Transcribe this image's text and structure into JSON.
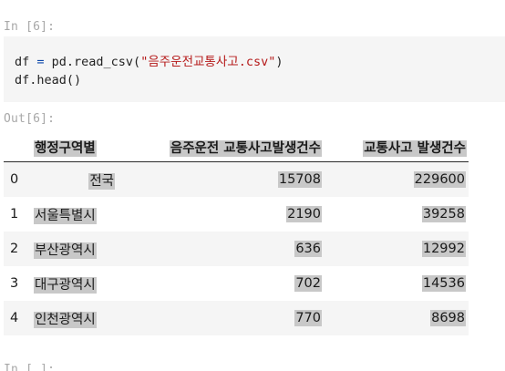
{
  "notebook": {
    "in_prompt": "In [6]:",
    "out_prompt": "Out[6]:",
    "next_prompt": "In [ ]:"
  },
  "code": {
    "line1_var": "df",
    "line1_op": " = ",
    "line1_call": "pd.read_csv(",
    "line1_str": "\"음주운전교통사고.csv\"",
    "line1_close": ")",
    "line2": "df.head()"
  },
  "table": {
    "headers": {
      "index": "",
      "region": "행정구역별",
      "drunk": "음주운전 교통사고발생건수",
      "total": "교통사고 발생건수"
    },
    "rows": [
      {
        "index": "0",
        "region": "전국",
        "drunk": "15708",
        "total": "229600"
      },
      {
        "index": "1",
        "region": "서울특별시",
        "drunk": "2190",
        "total": "39258"
      },
      {
        "index": "2",
        "region": "부산광역시",
        "drunk": "636",
        "total": "12992"
      },
      {
        "index": "3",
        "region": "대구광역시",
        "drunk": "702",
        "total": "14536"
      },
      {
        "index": "4",
        "region": "인천광역시",
        "drunk": "770",
        "total": "8698"
      }
    ]
  }
}
